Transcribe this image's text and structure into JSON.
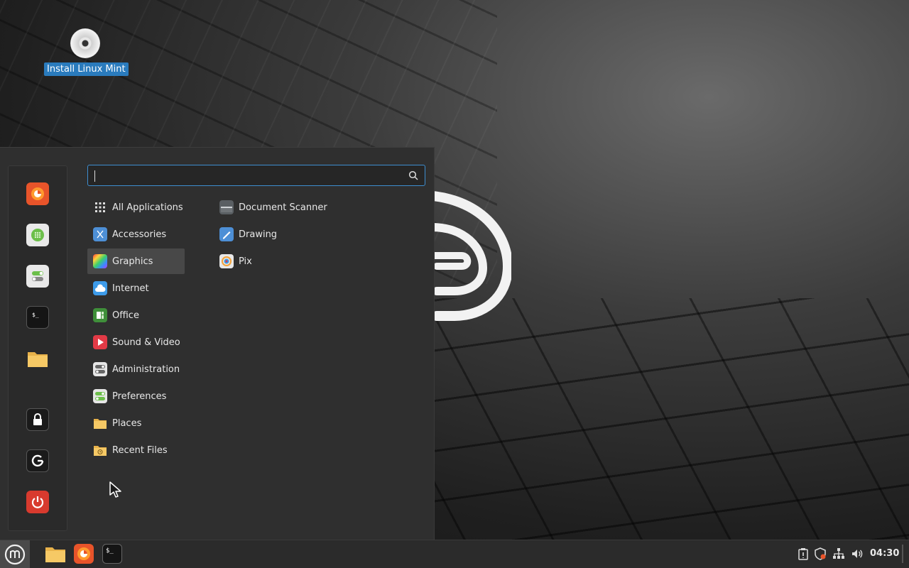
{
  "desktop": {
    "icons": [
      {
        "label": "Install Linux Mint",
        "icon": "disc-icon"
      }
    ]
  },
  "menu": {
    "search": {
      "value": "",
      "placeholder": ""
    },
    "favorites": [
      {
        "name": "firefox",
        "icon": "firefox-icon"
      },
      {
        "name": "software-manager",
        "icon": "software-manager-icon"
      },
      {
        "name": "system-settings",
        "icon": "settings-toggles-icon"
      },
      {
        "name": "terminal",
        "icon": "terminal-icon"
      },
      {
        "name": "files",
        "icon": "folder-icon"
      }
    ],
    "session_buttons": [
      {
        "name": "lock-screen",
        "icon": "lock-icon"
      },
      {
        "name": "log-out",
        "icon": "logout-icon"
      },
      {
        "name": "quit",
        "icon": "power-icon"
      }
    ],
    "categories": [
      {
        "label": "All Applications",
        "icon": "grid-icon"
      },
      {
        "label": "Accessories",
        "icon": "scissors-icon"
      },
      {
        "label": "Graphics",
        "icon": "palette-icon",
        "selected": true
      },
      {
        "label": "Internet",
        "icon": "cloud-icon"
      },
      {
        "label": "Office",
        "icon": "office-icon"
      },
      {
        "label": "Sound & Video",
        "icon": "play-icon"
      },
      {
        "label": "Administration",
        "icon": "admin-toggles-icon"
      },
      {
        "label": "Preferences",
        "icon": "preferences-toggles-icon"
      },
      {
        "label": "Places",
        "icon": "folder-icon"
      },
      {
        "label": "Recent Files",
        "icon": "recent-folder-icon"
      }
    ],
    "apps": [
      {
        "label": "Document Scanner",
        "icon": "scanner-icon"
      },
      {
        "label": "Drawing",
        "icon": "drawing-icon"
      },
      {
        "label": "Pix",
        "icon": "pix-icon"
      }
    ]
  },
  "taskbar": {
    "menu_button": "mint-menu-icon",
    "pinned": [
      "folder-icon",
      "firefox-icon",
      "terminal-icon"
    ],
    "tray": [
      "clipboard-icon",
      "shield-icon",
      "network-icon",
      "volume-icon"
    ],
    "clock": "04:30"
  },
  "colors": {
    "selection": "#2a7bbd",
    "search_focus": "#3e8ed0",
    "menu_bg": "#2f2f2f",
    "taskbar_bg": "#2b2b2b"
  }
}
